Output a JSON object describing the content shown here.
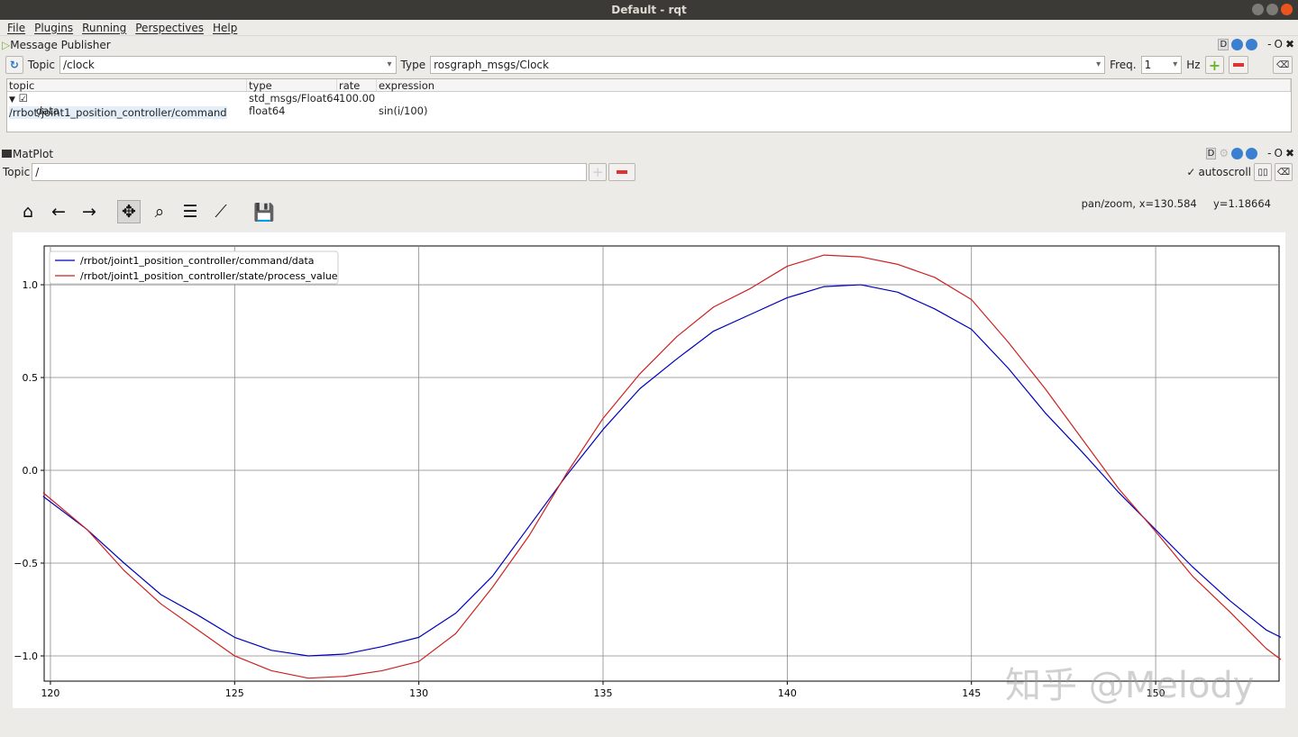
{
  "window": {
    "title": "Default - rqt"
  },
  "menu": [
    "File",
    "Plugins",
    "Running",
    "Perspectives",
    "Help"
  ],
  "publisher": {
    "title": "Message Publisher",
    "topic_label": "Topic",
    "topic_value": "/clock",
    "type_label": "Type",
    "type_value": "rosgraph_msgs/Clock",
    "freq_label": "Freq.",
    "freq_value": "1",
    "hz_label": "Hz",
    "columns": [
      "topic",
      "type",
      "rate",
      "expression"
    ],
    "rows": [
      {
        "topic": "/rrbot/joint1_position_controller/command",
        "type": "std_msgs/Float64",
        "rate": "100.00",
        "expression": "",
        "checked": true
      },
      {
        "topic": "data",
        "type": "float64",
        "rate": "",
        "expression": "sin(i/100)"
      }
    ]
  },
  "dock_controls": {
    "d": "D",
    "min": "-",
    "float": "O",
    "close": "✖"
  },
  "matplot": {
    "title": "MatPlot",
    "topic_label": "Topic",
    "topic_value": "/",
    "autoscroll_label": "autoscroll",
    "autoscroll": true,
    "status": "pan/zoom, x=130.584     y=1.18664"
  },
  "toolbar_icons": [
    "home-icon",
    "back-icon",
    "forward-icon",
    "pan-icon",
    "zoom-icon",
    "configure-icon",
    "edit-axes-icon",
    "save-icon"
  ],
  "watermark": "知乎 @Melody",
  "chart_data": {
    "type": "line",
    "xlim": [
      119.83,
      153.35
    ],
    "ylim": [
      -1.136,
      1.209
    ],
    "grid": true,
    "legend": "top-left",
    "xticks": [
      120,
      125,
      130,
      135,
      140,
      145,
      150
    ],
    "yticks": [
      1.0,
      0.5,
      0.0,
      -0.5,
      -1.0
    ],
    "x": [
      119.8,
      121,
      122,
      123,
      124,
      125,
      126,
      127,
      128,
      129,
      130,
      131,
      132,
      133,
      134,
      135,
      136,
      137,
      138,
      139,
      140,
      141,
      142,
      143,
      144,
      145,
      146,
      147,
      148,
      149,
      150,
      151,
      152,
      153,
      153.4
    ],
    "series": [
      {
        "name": "/rrbot/joint1_position_controller/command/data",
        "color": "#0000bb",
        "values": [
          -0.14,
          -0.32,
          -0.5,
          -0.67,
          -0.78,
          -0.9,
          -0.97,
          -1.0,
          -0.99,
          -0.95,
          -0.9,
          -0.77,
          -0.57,
          -0.3,
          -0.03,
          0.22,
          0.44,
          0.6,
          0.75,
          0.84,
          0.93,
          0.99,
          1.0,
          0.96,
          0.87,
          0.76,
          0.55,
          0.31,
          0.1,
          -0.12,
          -0.32,
          -0.52,
          -0.7,
          -0.86,
          -0.9
        ]
      },
      {
        "name": "/rrbot/joint1_position_controller/state/process_value",
        "color": "#cc2222",
        "values": [
          -0.12,
          -0.32,
          -0.54,
          -0.72,
          -0.86,
          -1.0,
          -1.08,
          -1.12,
          -1.11,
          -1.08,
          -1.03,
          -0.88,
          -0.63,
          -0.35,
          -0.02,
          0.28,
          0.52,
          0.72,
          0.88,
          0.98,
          1.1,
          1.16,
          1.15,
          1.11,
          1.04,
          0.92,
          0.69,
          0.44,
          0.17,
          -0.1,
          -0.33,
          -0.57,
          -0.76,
          -0.96,
          -1.02
        ]
      }
    ]
  }
}
